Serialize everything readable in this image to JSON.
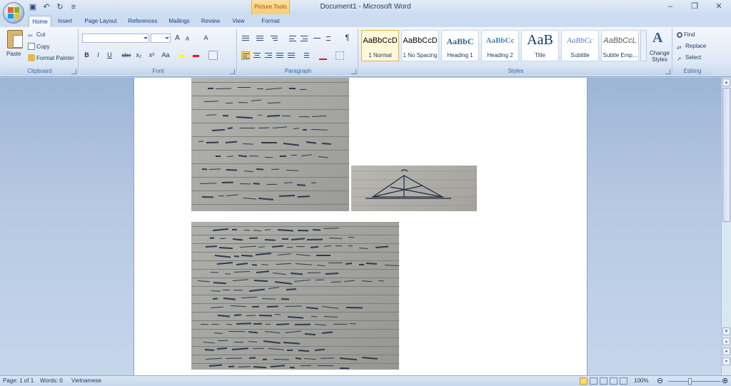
{
  "window": {
    "title": "Document1 - Microsoft Word",
    "context_tab_group": "Picture Tools",
    "controls": [
      "minimize",
      "restore",
      "close"
    ]
  },
  "quick_access": {
    "save_icon": "save-icon",
    "undo_icon": "undo-icon",
    "redo_icon": "redo-icon",
    "customize_icon": "customize-icon"
  },
  "tabs": [
    {
      "label": "Home",
      "active": true
    },
    {
      "label": "Insert"
    },
    {
      "label": "Page Layout"
    },
    {
      "label": "References"
    },
    {
      "label": "Mailings"
    },
    {
      "label": "Review"
    },
    {
      "label": "View"
    },
    {
      "label": "Format"
    }
  ],
  "ribbon": {
    "clipboard": {
      "label": "Clipboard",
      "paste": "Paste",
      "cut": "Cut",
      "copy": "Copy",
      "format_painter": "Format Painter"
    },
    "font": {
      "label": "Font",
      "bold": "B",
      "italic": "I",
      "underline": "U",
      "strikethrough": "abc",
      "subscript": "x₂",
      "superscript": "x²",
      "change_case": "Aa",
      "grow": "A",
      "shrink": "A",
      "clear": "A"
    },
    "paragraph": {
      "label": "Paragraph",
      "show_marks": "¶"
    },
    "styles": {
      "label": "Styles",
      "items": [
        {
          "preview": "AaBbCcD",
          "name": "1 Normal",
          "active": true
        },
        {
          "preview": "AaBbCcD",
          "name": "1 No Spacing"
        },
        {
          "preview": "AaBbC",
          "name": "Heading 1",
          "color": "#365f91"
        },
        {
          "preview": "AaBbCc",
          "name": "Heading 2",
          "color": "#4f81bd"
        },
        {
          "preview": "AaB",
          "name": "Title",
          "color": "#17365d"
        },
        {
          "preview": "AaBbCc",
          "name": "Subtitle",
          "color": "#4f81bd"
        },
        {
          "preview": "AaBbCcL",
          "name": "Subtle Emp..."
        }
      ],
      "change_styles": "Change Styles"
    },
    "editing": {
      "label": "Editing",
      "find": "Find",
      "replace": "Replace",
      "select": "Select"
    }
  },
  "statusbar": {
    "page": "Page: 1 of 1",
    "words": "Words: 0",
    "language": "Vietnamese",
    "zoom": "100%"
  }
}
